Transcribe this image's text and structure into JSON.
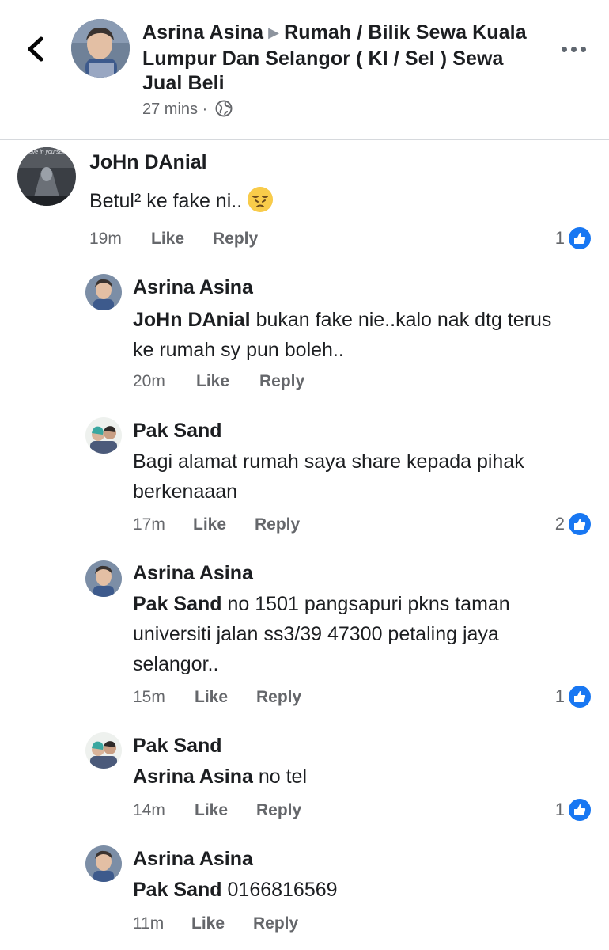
{
  "header": {
    "author": "Asrina Asina",
    "group": "Rumah / Bilik Sewa Kuala Lumpur Dan Selangor ( Kl / Sel ) Sewa Jual Beli",
    "time": "27 mins ·"
  },
  "comments": [
    {
      "author": "JoHn DAnial",
      "text": "Betul² ke fake ni..",
      "time": "19m",
      "like": "Like",
      "reply": "Reply",
      "reactions": "1"
    },
    {
      "author": "Asrina Asina",
      "mention": "JoHn DAnial",
      "text": " bukan fake nie..kalo nak dtg terus ke rumah sy pun boleh..",
      "time": "20m",
      "like": "Like",
      "reply": "Reply"
    },
    {
      "author": "Pak Sand",
      "text": "Bagi alamat rumah saya share kepada pihak berkenaaan",
      "time": "17m",
      "like": "Like",
      "reply": "Reply",
      "reactions": "2"
    },
    {
      "author": "Asrina Asina",
      "mention": "Pak Sand",
      "text": " no 1501 pangsapuri pkns taman universiti jalan ss3/39 47300 petaling jaya selangor..",
      "time": "15m",
      "like": "Like",
      "reply": "Reply",
      "reactions": "1"
    },
    {
      "author": "Pak Sand",
      "mention": "Asrina Asina",
      "text": " no tel",
      "time": "14m",
      "like": "Like",
      "reply": "Reply",
      "reactions": "1"
    },
    {
      "author": "Asrina Asina",
      "mention": "Pak Sand",
      "text": " 0166816569",
      "time": "11m",
      "like": "Like",
      "reply": "Reply"
    }
  ],
  "avatar_captions": {
    "john": "believe in yourself"
  },
  "colors": {
    "accent": "#1877f2",
    "meta": "#65676b",
    "divider": "#d6d9dd"
  }
}
